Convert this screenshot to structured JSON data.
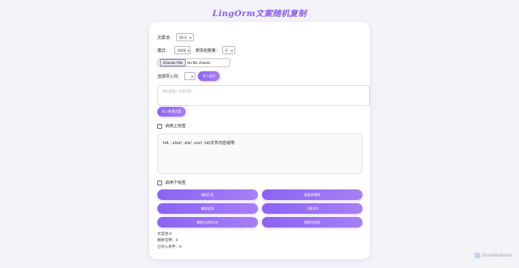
{
  "app": {
    "title": "LingOrm文案随机复制"
  },
  "controls": {
    "copy_count": {
      "label": "文案池：",
      "value": "00 A"
    },
    "mode": {
      "label": "模式：",
      "value": "0000"
    },
    "emoji": {
      "label": "表情包数量：",
      "value": "0"
    },
    "file": {
      "button": "Choose File",
      "status": "No file chosen"
    },
    "import": {
      "label": "选择导入列：",
      "value": "",
      "button": "导入运行"
    }
  },
  "input_area": {
    "placeholder": "请在此输入文案内容"
  },
  "add_button": "导入新增文案",
  "prefix_check": {
    "label": "启用上标签",
    "checked": false
  },
  "output": {
    "text": "txt, .xlsx/ .xls/ .csv/ .txt文件内容说明"
  },
  "suffix_check": {
    "label": "启用下标签",
    "checked": false
  },
  "actions": [
    "随机打乱",
    "复制并删除",
    "删除此条",
    "下载文件",
    "删除全部Excel",
    "清除全部池"
  ],
  "stats": {
    "line1": "文案池:0",
    "line2": "剩余可用：0",
    "line3": "已导入条件：0"
  },
  "brand": {
    "name": "ScanMalware"
  },
  "colors": {
    "accent": "#8b63f2",
    "accent_light": "#a77ff5",
    "background": "#f3f3f8"
  }
}
